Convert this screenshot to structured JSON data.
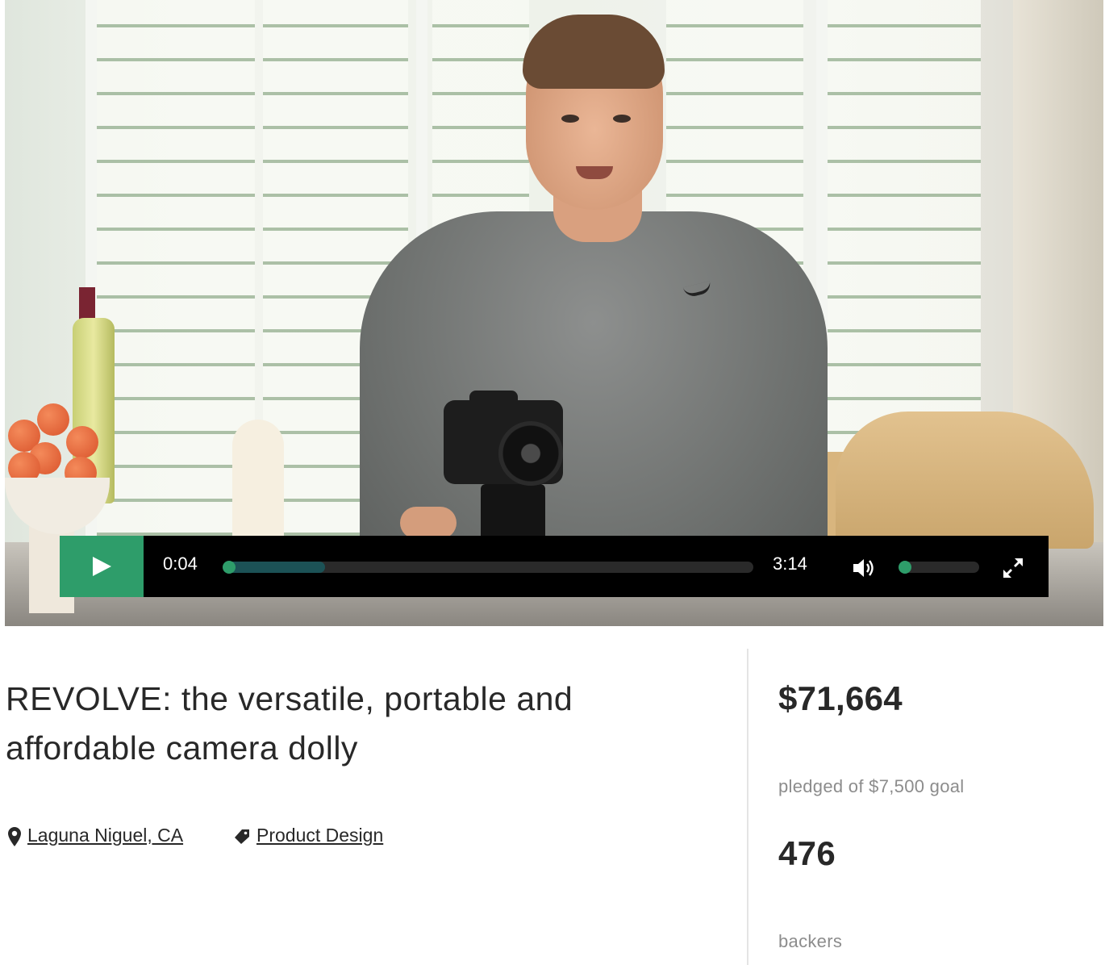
{
  "video": {
    "current_time": "0:04",
    "duration": "3:14",
    "progress_fraction": 0.19,
    "volume_fraction": 0.1,
    "accent_color": "#2e9d6a"
  },
  "project": {
    "title": "REVOLVE: the versatile, portable and affordable camera dolly",
    "location": "Laguna Niguel, CA",
    "category": "Product Design",
    "location_icon": "map-pin-icon",
    "category_icon": "tag-icon"
  },
  "stats": {
    "pledged_amount": "$71,664",
    "pledged_label": "pledged of $7,500 goal",
    "backers_count": "476",
    "backers_label": "backers"
  }
}
